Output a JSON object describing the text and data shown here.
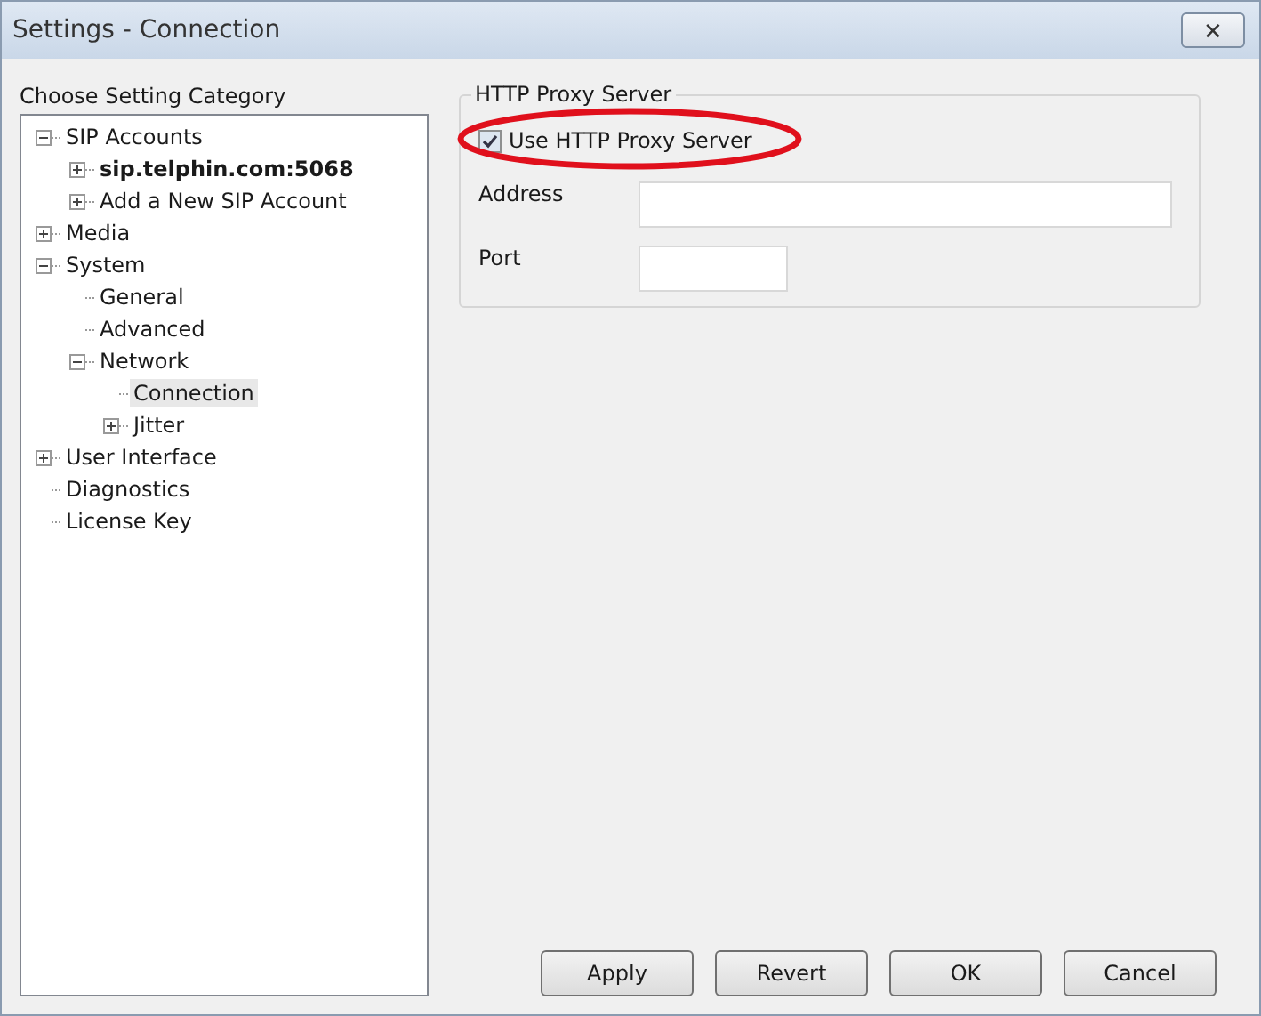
{
  "window": {
    "title": "Settings - Connection",
    "close": "✕"
  },
  "category_panel": {
    "label": "Choose Setting Category",
    "tree": [
      {
        "label": "SIP Accounts",
        "expanded": true,
        "selected": false,
        "children": [
          {
            "label": "sip.telphin.com:5068",
            "bold": true,
            "expanded": false,
            "selected": false
          },
          {
            "label": "Add a New SIP Account",
            "expanded": false,
            "selected": false
          }
        ]
      },
      {
        "label": "Media",
        "expanded": false,
        "selected": false
      },
      {
        "label": "System",
        "expanded": true,
        "selected": false,
        "children": [
          {
            "label": "General",
            "selected": false
          },
          {
            "label": "Advanced",
            "selected": false
          },
          {
            "label": "Network",
            "expanded": true,
            "selected": false,
            "children": [
              {
                "label": "Connection",
                "selected": true
              },
              {
                "label": "Jitter",
                "expanded": false,
                "selected": false
              }
            ]
          }
        ]
      },
      {
        "label": "User Interface",
        "expanded": false,
        "selected": false
      },
      {
        "label": "Diagnostics",
        "selected": false
      },
      {
        "label": "License Key",
        "selected": false
      }
    ]
  },
  "proxy_group": {
    "title": "HTTP Proxy Server",
    "use_proxy": {
      "label": "Use HTTP Proxy Server",
      "checked": true
    },
    "fields": [
      {
        "label": "Address",
        "kind": "wide"
      },
      {
        "label": "Port",
        "kind": "narrow"
      }
    ]
  },
  "highlight": {
    "kind": "ellipse",
    "color": "#e0101c"
  },
  "buttons": [
    "Apply",
    "Revert",
    "OK",
    "Cancel"
  ]
}
